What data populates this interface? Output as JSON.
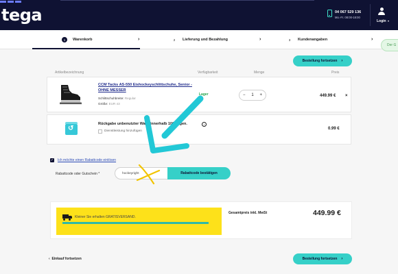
{
  "header": {
    "logo": "tega",
    "phone": "04 067 529 136",
    "hours": "Mo.-Fr. 08:00-18:00",
    "login": "Login"
  },
  "steps": [
    {
      "num": "1",
      "label": "Warenkorb"
    },
    {
      "num": "2",
      "label": "Lieferung und Bezahlung"
    },
    {
      "num": "3",
      "label": "Kundenangaben"
    }
  ],
  "toast": "Der G",
  "buttons": {
    "continue_top": "Bestellung fortsetzen",
    "continue_bottom": "Bestellung fortsetzen",
    "apply_code": "Rabattcode bestätigen"
  },
  "table": {
    "headers": [
      "Artikelbezeichnung",
      "Verfügbarkeit",
      "Menge",
      "Preis"
    ]
  },
  "product": {
    "title": "CCM Tacks AS-550 Eishockeyschlittschuhe, Senior - OHNE MESSER",
    "attrs": [
      {
        "k": "Schlittschuhbreite:",
        "v": "Regular"
      },
      {
        "k": "Größe:",
        "v": "EUR 43"
      }
    ],
    "availability": "Lager",
    "qty_minus": "−",
    "qty": "1",
    "qty_plus": "+",
    "price": "449.99 €",
    "remove": "×"
  },
  "return": {
    "title": "Rückgabe unbenutzter Ware innerhalb 100 Tagen.",
    "checkbox_label": "Dienstleistung hinzufügen",
    "price": "0.99 €",
    "info": "i"
  },
  "rabatt": {
    "check": "✓",
    "link": "Ich möchte einen Rabattcode einlösen",
    "label": "Rabattcode oder Gutschein *",
    "input_value": "hockeyright"
  },
  "summary": {
    "promo": "Kleiner Sie erhalten GRATISVERSAND.",
    "progress": 1.0,
    "total_label": "Gesamtpreis inkl. MwSt",
    "total_value": "449.99 €"
  },
  "back_link": "Einkauf fortsetzen",
  "colors": {
    "navy": "#0f1233",
    "teal": "#36d0c8",
    "yellow": "#fde11a",
    "green": "#22a34a",
    "annotation": "#22c8d6"
  }
}
